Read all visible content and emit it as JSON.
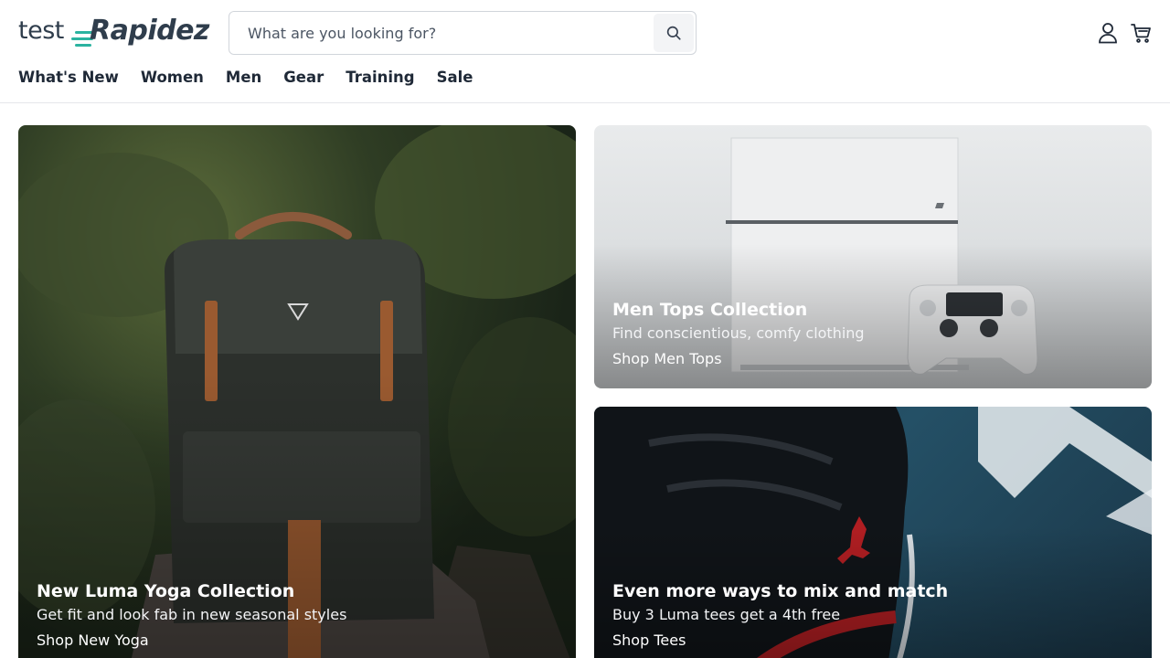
{
  "brand": {
    "prefix": "test",
    "name": "Rapidez"
  },
  "search": {
    "placeholder": "What are you looking for?"
  },
  "icons": {
    "search": "search-icon",
    "account": "user-icon",
    "cart": "cart-icon"
  },
  "nav": [
    {
      "label": "What's New"
    },
    {
      "label": "Women"
    },
    {
      "label": "Men"
    },
    {
      "label": "Gear"
    },
    {
      "label": "Training"
    },
    {
      "label": "Sale"
    }
  ],
  "promos": [
    {
      "title": "New Luma Yoga Collection",
      "subtitle": "Get fit and look fab in new seasonal styles",
      "link": "Shop New Yoga"
    },
    {
      "title": "Men Tops Collection",
      "subtitle": "Find conscientious, comfy clothing",
      "link": "Shop Men Tops"
    },
    {
      "title": "Even more ways to mix and match",
      "subtitle": "Buy 3 Luma tees get a 4th free",
      "link": "Shop Tees"
    }
  ],
  "colors": {
    "accent": "#2bb3a0",
    "text": "#1f2937",
    "border": "#e5e7eb"
  }
}
